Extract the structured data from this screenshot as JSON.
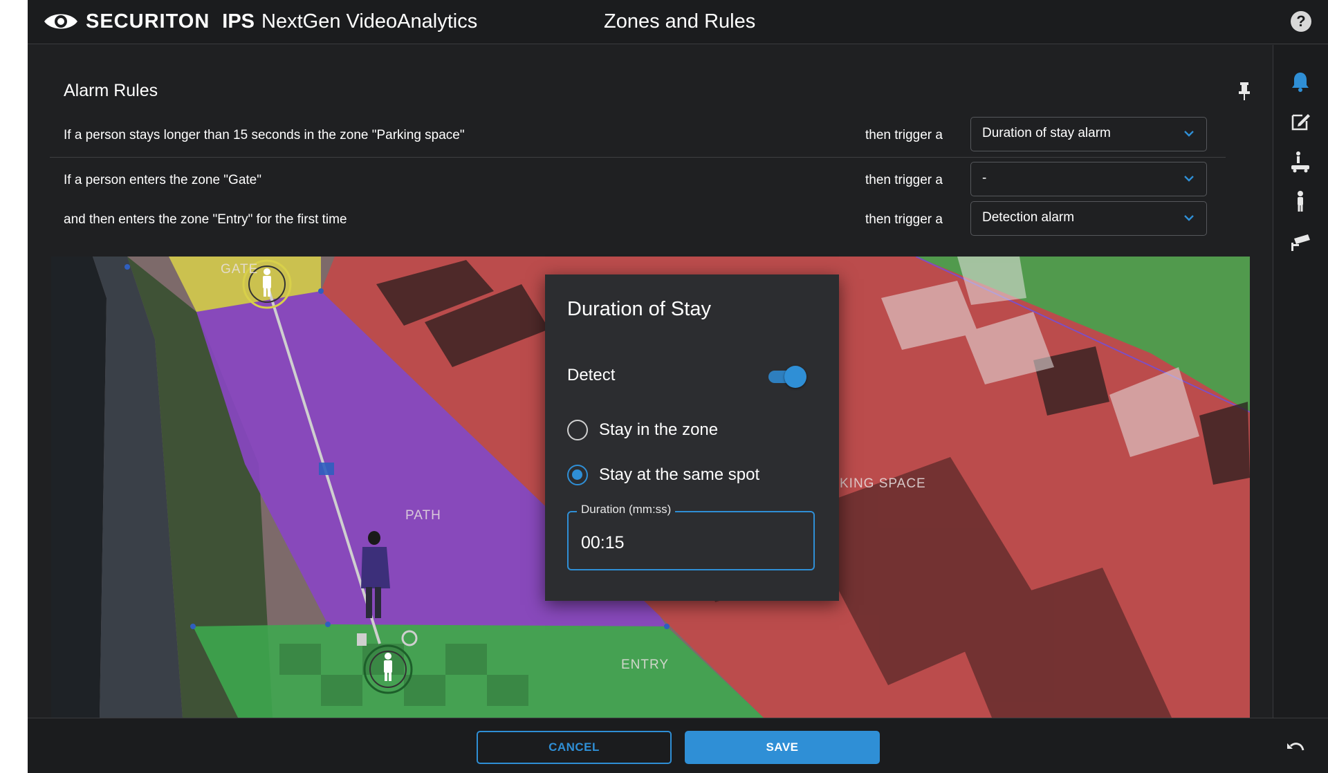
{
  "header": {
    "brand_main": "SECURITON",
    "brand_product": "IPS",
    "brand_sub": "NextGen VideoAnalytics",
    "title": "Zones and Rules",
    "help_icon": "question-circle-icon"
  },
  "rules": {
    "title": "Alarm Rules",
    "items": [
      {
        "text": "If a person stays longer than 15 seconds in the zone \"Parking space\"",
        "trigger_text": "then trigger a",
        "alarm": "Duration of stay alarm"
      },
      {
        "text": "If a person enters the zone \"Gate\"",
        "trigger_text": "then trigger a",
        "alarm": "-"
      },
      {
        "text": "and then enters the zone \"Entry\" for the first time",
        "trigger_text": "then trigger a",
        "alarm": "Detection alarm"
      }
    ]
  },
  "sidebar": {
    "icons": [
      "bell-icon",
      "edit-icon",
      "scene-object-icon",
      "person-icon",
      "camera-icon"
    ],
    "active_color": "#2f8fd6"
  },
  "scene": {
    "zones": {
      "gate": "GATE",
      "path": "PATH",
      "parking": "KING SPACE",
      "entry": "ENTRY"
    },
    "zone_colors": {
      "gate": "#d8d04a",
      "path": "#8a46c4",
      "parking": "#c44848",
      "entry": "#3ea84e",
      "green_top": "#3ea84e"
    }
  },
  "dialog": {
    "title": "Duration of Stay",
    "detect_label": "Detect",
    "detect_on": true,
    "options": [
      {
        "label": "Stay in the zone",
        "selected": false
      },
      {
        "label": "Stay at the same spot",
        "selected": true
      }
    ],
    "duration_label": "Duration (mm:ss)",
    "duration_value": "00:15"
  },
  "footer": {
    "cancel_label": "CANCEL",
    "save_label": "SAVE",
    "undo_icon": "undo-icon"
  },
  "colors": {
    "accent": "#2f8fd6",
    "background": "#1f2022"
  }
}
